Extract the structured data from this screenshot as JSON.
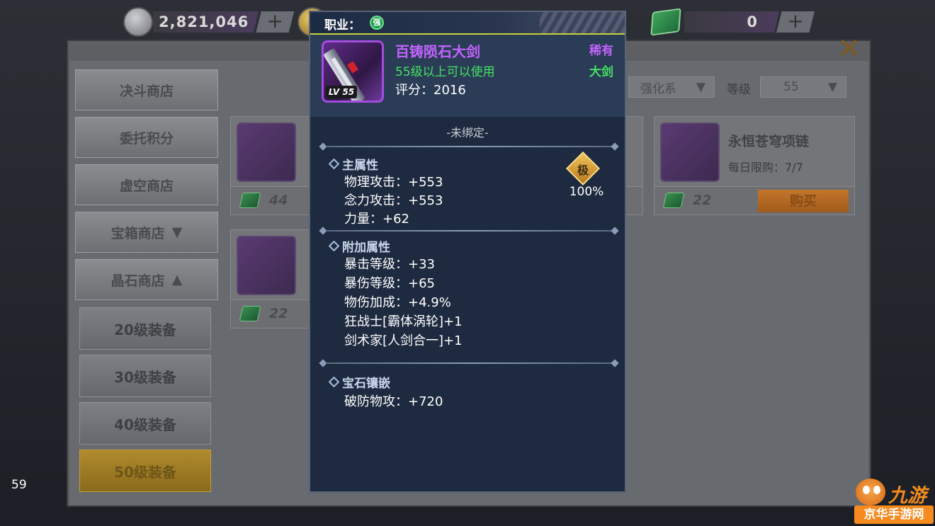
{
  "currency": {
    "coin_amount": "2,821,046",
    "gem_amount": "0",
    "plus_symbol": "+"
  },
  "sidebar": {
    "items": [
      {
        "label": "决斗商店"
      },
      {
        "label": "委托积分"
      },
      {
        "label": "虚空商店"
      },
      {
        "label": "宝箱商店",
        "chevron": "▼"
      },
      {
        "label": "晶石商店",
        "chevron": "▲"
      }
    ],
    "sub_items": [
      {
        "label": "20级装备"
      },
      {
        "label": "30级装备"
      },
      {
        "label": "40级装备"
      },
      {
        "label": "50级装备"
      }
    ]
  },
  "filters": {
    "type_value": "强化系",
    "level_label": "等级",
    "level_value": "55",
    "chevron": "▼"
  },
  "cards": [
    {
      "name": "",
      "limit": "",
      "price": "44",
      "buy_label": ""
    },
    {
      "name": "",
      "limit": "",
      "price": "22",
      "buy_label": ""
    },
    {
      "name": "永恒苍穹项链",
      "limit": "每日限购：7/7",
      "price": "22",
      "buy_label": "购买"
    },
    {
      "name": "",
      "limit": "",
      "price": "22",
      "buy_label": ""
    }
  ],
  "fps": "59",
  "watermark": {
    "brand": "九游",
    "site": "京华手游网"
  },
  "tooltip": {
    "job_label": "职业：",
    "job_icon_char": "强",
    "item_name": "百铸陨石大剑",
    "requirement": "55级以上可以使用",
    "score": "评分：2016",
    "rarity": "稀有",
    "weapon_type": "大剑",
    "level_badge": "LV 55",
    "bind_status": "-未绑定-",
    "grade_char": "极",
    "grade_percent": "100%",
    "main_title": "主属性",
    "main_stats": [
      "物理攻击：+553",
      "念力攻击：+553",
      "力量：+62"
    ],
    "extra_title": "附加属性",
    "extra_stats": [
      "暴击等级：+33",
      "暴伤等级：+65",
      "物伤加成：+4.9%",
      "狂战士[霸体涡轮]+1",
      "剑术家[人剑合一]+1"
    ],
    "gem_title": "宝石镶嵌",
    "gem_stats": [
      "破防物攻：+720"
    ]
  },
  "colors": {
    "epic_purple": "#c464ff",
    "usable_green": "#45e262",
    "tooltip_bg": "#1e2a3f",
    "accent_line": "#c7d23a"
  }
}
